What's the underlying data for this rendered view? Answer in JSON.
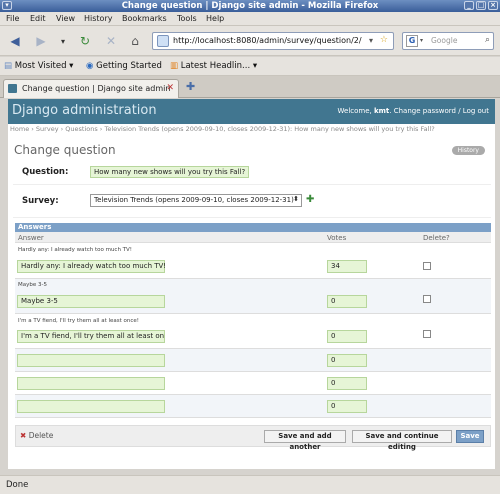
{
  "window": {
    "title": "Change question | Django site admin - Mozilla Firefox"
  },
  "menu": {
    "items": [
      "File",
      "Edit",
      "View",
      "History",
      "Bookmarks",
      "Tools",
      "Help"
    ]
  },
  "nav": {
    "url": "http://localhost:8080/admin/survey/question/2/",
    "search_placeholder": "Google"
  },
  "bookmarks": {
    "items": [
      "Most Visited",
      "Getting Started",
      "Latest Headlin..."
    ]
  },
  "tabs": {
    "active": "Change question | Django site admin"
  },
  "admin": {
    "brand": "Django administration",
    "welcome": "Welcome,",
    "username": "kmt",
    "links": ". Change password / Log out"
  },
  "breadcrumbs": "Home › Survey › Questions › Television Trends (opens 2009-09-10, closes 2009-12-31): How many new shows will you try this Fall?",
  "page": {
    "title": "Change question",
    "history_button": "History",
    "question_label": "Question:",
    "question_value": "How many new shows will you try this Fall?",
    "survey_label": "Survey:",
    "survey_value": "Television Trends (opens 2009-09-10, closes 2009-12-31)"
  },
  "answers": {
    "heading": "Answers",
    "columns": [
      "Answer",
      "Votes",
      "Delete?"
    ],
    "rows": [
      {
        "caption": "Hardly any: I already watch too much TV!",
        "answer": "Hardly any: I already watch too much TV!",
        "votes": "34"
      },
      {
        "caption": "Maybe 3-5",
        "answer": "Maybe 3-5",
        "votes": "0"
      },
      {
        "caption": "I'm a TV fiend, I'll try them all at least once!",
        "answer": "I'm a TV fiend, I'll try them all at least onc",
        "votes": "0"
      },
      {
        "caption": "",
        "answer": "",
        "votes": "0"
      },
      {
        "caption": "",
        "answer": "",
        "votes": "0"
      },
      {
        "caption": "",
        "answer": "",
        "votes": "0"
      }
    ]
  },
  "submit": {
    "delete": "Delete",
    "save_add": "Save and add another",
    "save_continue": "Save and continue editing",
    "save": "Save"
  },
  "status": {
    "text": "Done"
  }
}
